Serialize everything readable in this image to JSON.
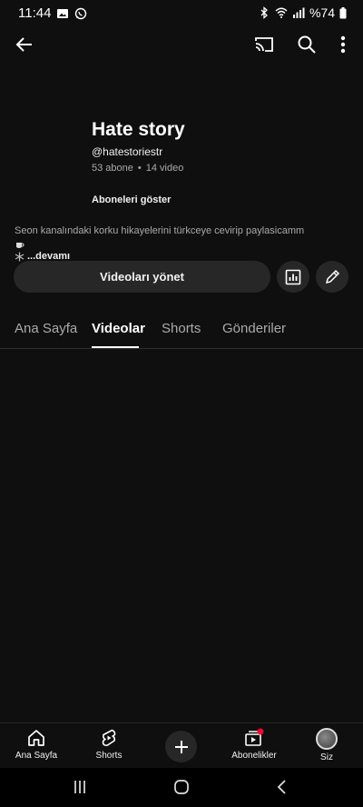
{
  "status_bar": {
    "time": "11:44",
    "battery": "%74",
    "icons": [
      "gallery-icon",
      "whatsapp-icon",
      "bluetooth-icon",
      "wifi-icon",
      "signal-icon",
      "battery-icon"
    ]
  },
  "topbar": {
    "icons": [
      "back-arrow-icon",
      "cast-icon",
      "search-icon",
      "more-vert-icon"
    ]
  },
  "channel": {
    "title": "Hate story",
    "handle": "@hatestoriestr",
    "subscribers": "53 abone",
    "separator": "•",
    "videos": "14 video",
    "subs_link": "Aboneleri göster",
    "description_line1": "Seon kanalındaki korku hikayelerini türkceye cevirip paylasicamm",
    "more_label": "...devamı"
  },
  "actions": {
    "manage_label": "Videoları yönet",
    "analytics_icon": "analytics-icon",
    "edit_icon": "pencil-icon"
  },
  "tabs": [
    {
      "label": "Ana Sayfa",
      "active": false
    },
    {
      "label": "Videolar",
      "active": true
    },
    {
      "label": "Shorts",
      "active": false
    },
    {
      "label": "Gönderiler",
      "active": false
    }
  ],
  "bottom_nav": {
    "home": "Ana Sayfa",
    "shorts": "Shorts",
    "subscriptions": "Abonelikler",
    "you": "Siz"
  },
  "colors": {
    "background": "#0f0f0f",
    "surface": "#272727",
    "text_primary": "#f1f1f1",
    "text_secondary": "#aaaaaa",
    "notification_dot": "#ff0033"
  }
}
